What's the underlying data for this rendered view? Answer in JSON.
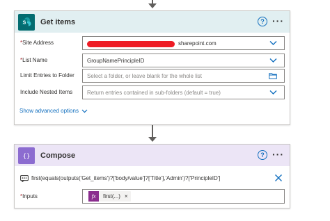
{
  "get_items": {
    "title": "Get items",
    "help_label": "?",
    "more_label": "···",
    "icon": "sharepoint-icon",
    "site_address": {
      "label": "Site Address",
      "required_mark": "*",
      "value": "sharepoint.com"
    },
    "list_name": {
      "label": "List Name",
      "required_mark": "*",
      "value": "GroupNamePrincipleID"
    },
    "limit_folder": {
      "label": "Limit Entries to Folder",
      "placeholder": "Select a folder, or leave blank for the whole list"
    },
    "nested_items": {
      "label": "Include Nested Items",
      "placeholder": "Return entries contained in sub-folders (default = true)"
    },
    "advanced_link": "Show advanced options"
  },
  "compose": {
    "title": "Compose",
    "help_label": "?",
    "more_label": "···",
    "icon": "compose-icon",
    "expression": "first(equals(outputs('Get_items')?['body/value']?['Title'],'Admin')?['PrincipleID']",
    "inputs": {
      "label": "Inputs",
      "required_mark": "*",
      "token_label": "first(...)",
      "token_icon_text": "fx",
      "token_remove": "×"
    }
  },
  "colors": {
    "sharepoint_header": "#e1eff1",
    "sharepoint_icon": "#036c70",
    "compose_header": "#ece5f6",
    "compose_icon": "#8c6cd0",
    "accent": "#106ebe",
    "token": "#8a2d8e",
    "redaction": "#ee1c25"
  }
}
